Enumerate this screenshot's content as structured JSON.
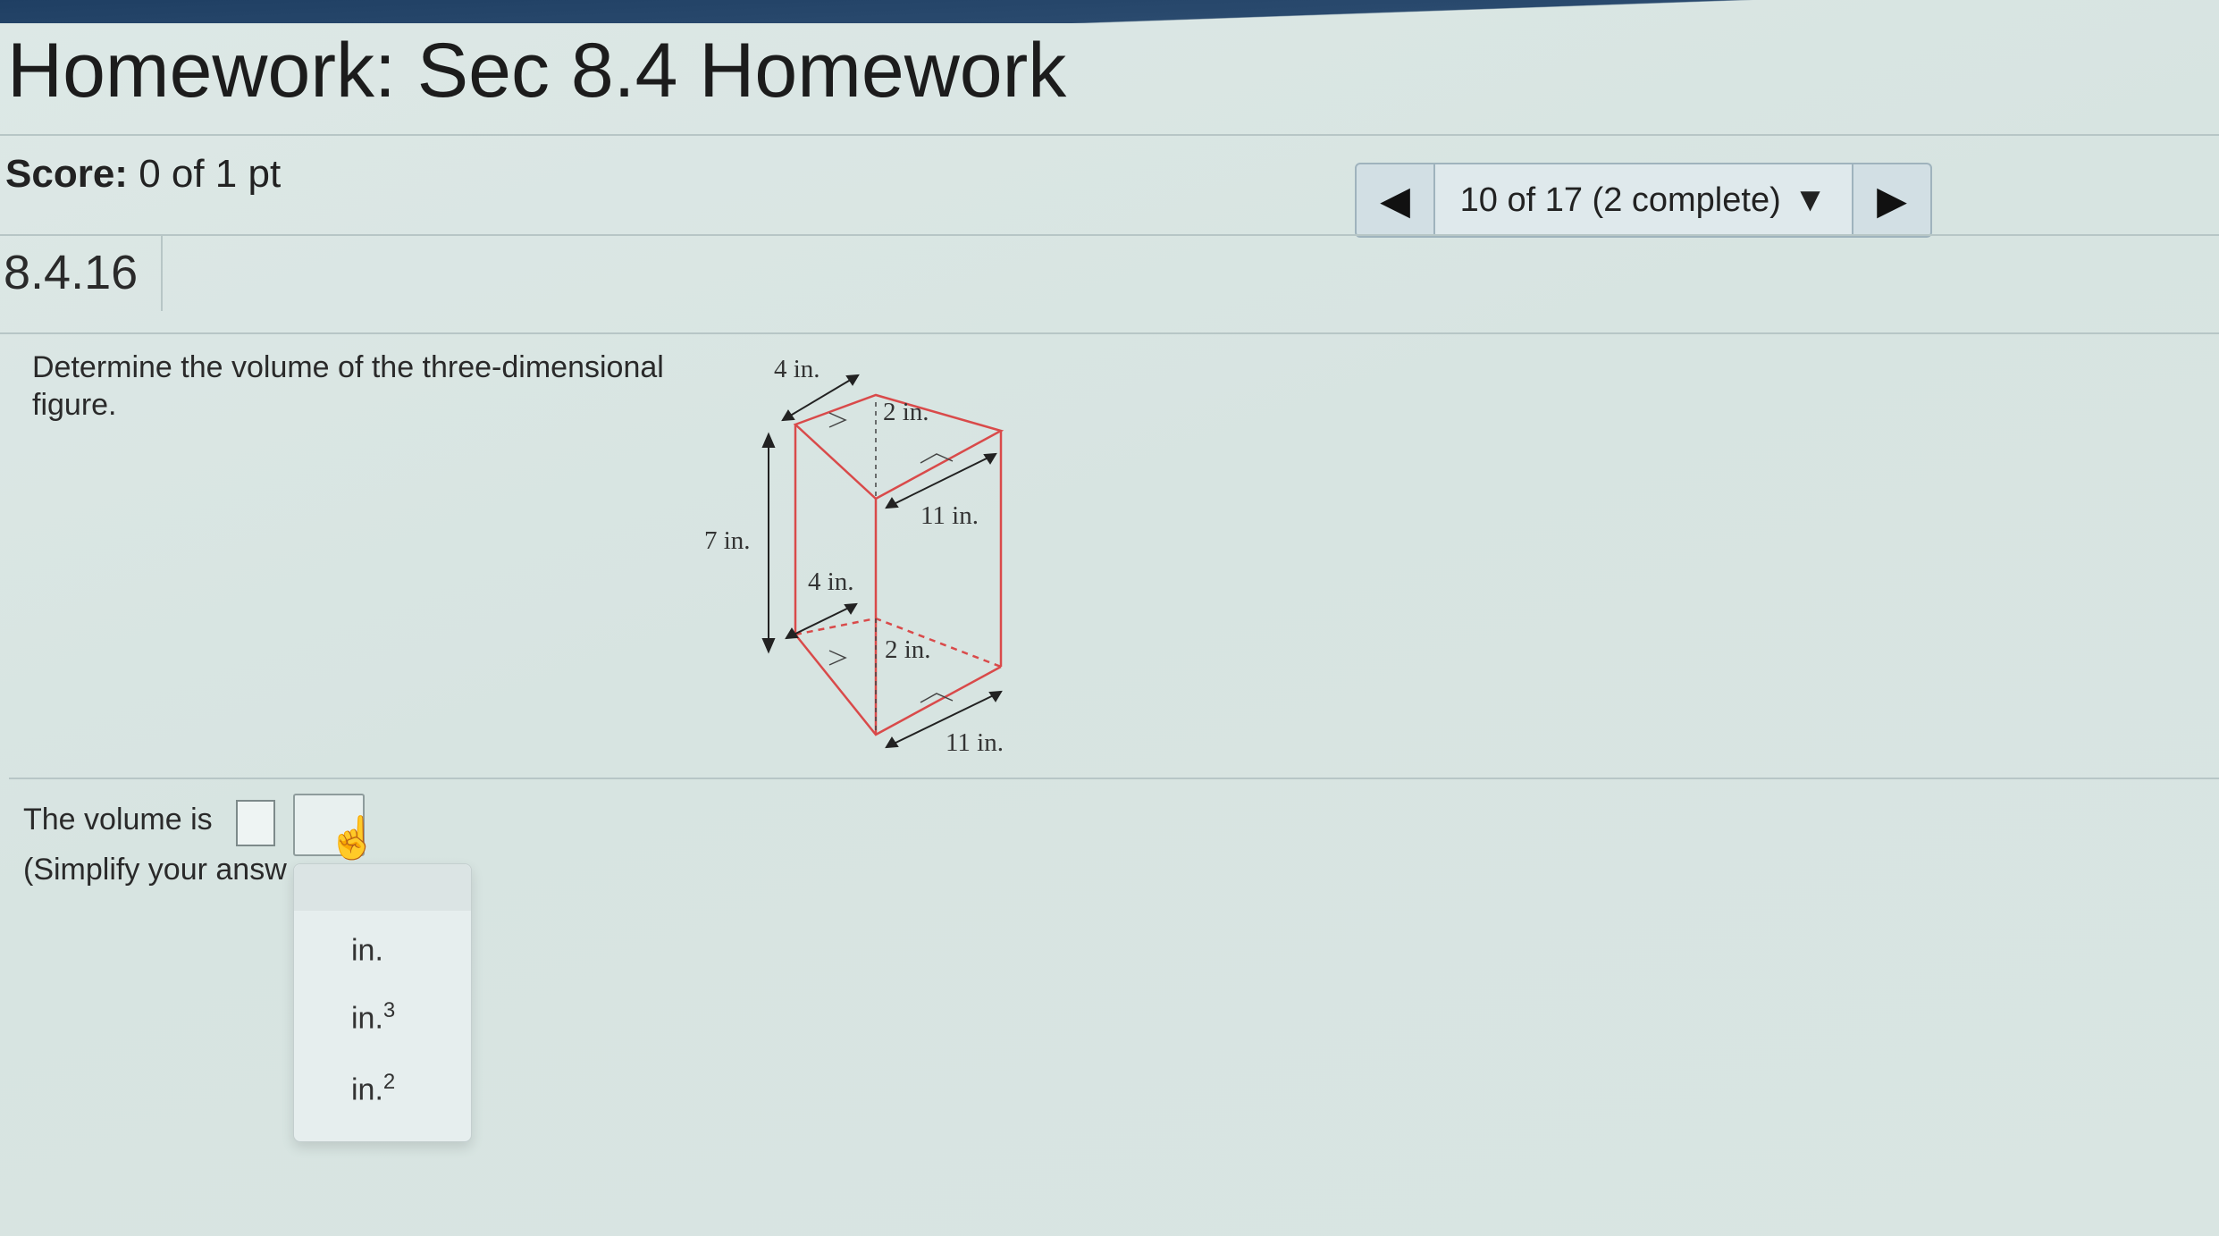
{
  "header": {
    "title": "Homework: Sec 8.4 Homework"
  },
  "score": {
    "label": "Score:",
    "value": "0 of 1 pt"
  },
  "navigator": {
    "prev_icon": "triangle-left-icon",
    "status": "10 of 17 (2 complete)",
    "dropdown_icon": "triangle-down-icon",
    "next_icon": "triangle-right-icon"
  },
  "question": {
    "number": "8.4.16",
    "prompt": "Determine the volume of the three-dimensional figure.",
    "figure_labels": {
      "top_width": "4 in.",
      "top_height": "2 in.",
      "top_length": "11 in.",
      "prism_height": "7 in.",
      "bottom_width": "4 in.",
      "bottom_height": "2 in.",
      "bottom_length": "11 in."
    }
  },
  "answer": {
    "prefix": "The volume is",
    "instruction": "(Simplify your answ",
    "value": "",
    "unit_selected": ""
  },
  "unit_dropdown": {
    "options": [
      {
        "base": "in.",
        "exp": ""
      },
      {
        "base": "in.",
        "exp": "3"
      },
      {
        "base": "in.",
        "exp": "2"
      }
    ]
  },
  "colors": {
    "figure_edges": "#d94a4a",
    "topbar": "#1f3f63"
  }
}
